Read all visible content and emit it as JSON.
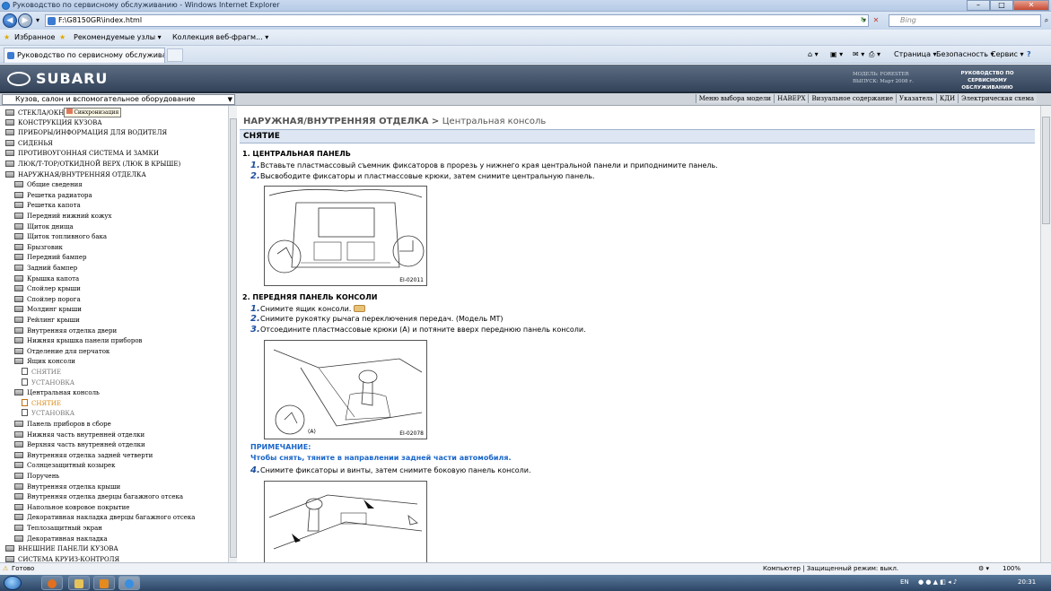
{
  "window": {
    "title": "Руководство по сервисному обслуживанию - Windows Internet Explorer"
  },
  "address": {
    "url": "F:\\G8150GR\\index.html",
    "search_placeholder": "Bing"
  },
  "favorites": {
    "label": "Избранное",
    "recommended": "Рекомендуемые узлы ▾",
    "gallery": "Коллекция веб-фрагм... ▾"
  },
  "tab": {
    "title": "Руководство по сервисному обслуживанию"
  },
  "commandbar": {
    "page": "Страница ▾",
    "safety": "Безопасность ▾",
    "tools": "Сервис ▾",
    "help": "?"
  },
  "banner": {
    "logo": "SUBARU",
    "model_line1": "МОДЕЛЬ: FORESTER",
    "model_line2": "ВЫПУСК: Март 2008 г.",
    "manual_line1": "РУКОВОДСТВО ПО",
    "manual_line2": "СЕРВИСНОМУ ОБСЛУЖИВАНИЮ"
  },
  "subbar": {
    "section": "Кузов, салон и вспомогательное оборудование",
    "links": [
      "Меню выбора модели",
      "НАВЕРХ",
      "Визуальное содержание",
      "Указатель",
      "КДИ",
      "Электрическая схема"
    ]
  },
  "tree": [
    {
      "label": "СТЕКЛА/ОКН",
      "level": 0,
      "kind": "folder"
    },
    {
      "label": "КОНСТРУКЦИЯ КУЗОВА",
      "level": 0,
      "kind": "folder"
    },
    {
      "label": "ПРИБОРЫ/ИНФОРМАЦИЯ ДЛЯ ВОДИТЕЛЯ",
      "level": 0,
      "kind": "folder"
    },
    {
      "label": "СИДЕНЬЯ",
      "level": 0,
      "kind": "folder"
    },
    {
      "label": "ПРОТИВОУГОННАЯ СИСТЕМА И ЗАМКИ",
      "level": 0,
      "kind": "folder"
    },
    {
      "label": "ЛЮК/Т-ТОР/ОТКИДНОЙ ВЕРХ (ЛЮК В КРЫШЕ)",
      "level": 0,
      "kind": "folder"
    },
    {
      "label": "НАРУЖНАЯ/ВНУТРЕННЯЯ ОТДЕЛКА",
      "level": 0,
      "kind": "folder"
    },
    {
      "label": "Общие сведения",
      "level": 1,
      "kind": "folder"
    },
    {
      "label": "Решетка радиатора",
      "level": 1,
      "kind": "folder"
    },
    {
      "label": "Решетка капота",
      "level": 1,
      "kind": "folder"
    },
    {
      "label": "Передний нижний кожух",
      "level": 1,
      "kind": "folder"
    },
    {
      "label": "Щиток днища",
      "level": 1,
      "kind": "folder"
    },
    {
      "label": "Щиток топливного бака",
      "level": 1,
      "kind": "folder"
    },
    {
      "label": "Брызговик",
      "level": 1,
      "kind": "folder"
    },
    {
      "label": "Передний бампер",
      "level": 1,
      "kind": "folder"
    },
    {
      "label": "Задний бампер",
      "level": 1,
      "kind": "folder"
    },
    {
      "label": "Крышка капота",
      "level": 1,
      "kind": "folder"
    },
    {
      "label": "Спойлер крыши",
      "level": 1,
      "kind": "folder"
    },
    {
      "label": "Спойлер порога",
      "level": 1,
      "kind": "folder"
    },
    {
      "label": "Молдинг крыши",
      "level": 1,
      "kind": "folder"
    },
    {
      "label": "Рейлинг крыши",
      "level": 1,
      "kind": "folder"
    },
    {
      "label": "Внутренняя отделка двери",
      "level": 1,
      "kind": "folder"
    },
    {
      "label": "Нижняя крышка панели приборов",
      "level": 1,
      "kind": "folder"
    },
    {
      "label": "Отделение для перчаток",
      "level": 1,
      "kind": "folder"
    },
    {
      "label": "Ящик консоли",
      "level": 1,
      "kind": "folder"
    },
    {
      "label": "СНЯТИЕ",
      "level": 2,
      "kind": "doc"
    },
    {
      "label": "УСТАНОВКА",
      "level": 2,
      "kind": "doc"
    },
    {
      "label": "Центральная консоль",
      "level": 1,
      "kind": "folder"
    },
    {
      "label": "СНЯТИЕ",
      "level": 2,
      "kind": "active"
    },
    {
      "label": "УСТАНОВКА",
      "level": 2,
      "kind": "doc"
    },
    {
      "label": "Панель приборов в сборе",
      "level": 1,
      "kind": "folder"
    },
    {
      "label": "Нижняя часть внутренней отделки",
      "level": 1,
      "kind": "folder"
    },
    {
      "label": "Верхняя часть внутренней отделки",
      "level": 1,
      "kind": "folder"
    },
    {
      "label": "Внутренняя отделка задней четверти",
      "level": 1,
      "kind": "folder"
    },
    {
      "label": "Солнцезащитный козырек",
      "level": 1,
      "kind": "folder"
    },
    {
      "label": "Поручень",
      "level": 1,
      "kind": "folder"
    },
    {
      "label": "Внутренняя отделка крыши",
      "level": 1,
      "kind": "folder"
    },
    {
      "label": "Внутренняя отделка дверцы багажного отсека",
      "level": 1,
      "kind": "folder"
    },
    {
      "label": "Напольное ковровое покрытие",
      "level": 1,
      "kind": "folder"
    },
    {
      "label": "Декоративная накладка дверцы багажного отсека",
      "level": 1,
      "kind": "folder"
    },
    {
      "label": "Теплозащитный экран",
      "level": 1,
      "kind": "folder"
    },
    {
      "label": "Декоративная накладка",
      "level": 1,
      "kind": "folder"
    },
    {
      "label": "ВНЕШНИЕ ПАНЕЛИ КУЗОВА",
      "level": 0,
      "kind": "folder"
    },
    {
      "label": "СИСТЕМА КРУИЗ-КОНТРОЛЯ",
      "level": 0,
      "kind": "folder"
    }
  ],
  "tooltip": "Синхронизация",
  "content": {
    "breadcrumb": "НАРУЖНАЯ/ВНУТРЕННЯЯ ОТДЕЛКА > ",
    "breadcrumb_current": "Центральная консоль",
    "section_title": "СНЯТИЕ",
    "h1": "1. ЦЕНТРАЛЬНАЯ ПАНЕЛЬ",
    "s1_1": "Вставьте пластмассовый съемник фиксаторов в прорезь у нижнего края центральной панели и приподнимите панель.",
    "s1_2": "Высвободите фиксаторы и пластмассовые крюки, затем снимите центральную панель.",
    "fig1": "EI-02011",
    "h2": "2. ПЕРЕДНЯЯ ПАНЕЛЬ КОНСОЛИ",
    "s2_1": "Снимите ящик консоли.",
    "s2_2": "Снимите рукоятку рычага переключения передач. (Модель МТ)",
    "s2_3": "Отсоедините пластмассовые крюки (А) и потяните вверх переднюю панель консоли.",
    "fig2": "EI-02078",
    "fig2_a": "(A)",
    "note_title": "ПРИМЕЧАНИЕ:",
    "note_text": "Чтобы снять, тяните в направлении задней части автомобиля.",
    "s2_4": "Снимите фиксаторы и винты, затем снимите боковую панель консоли.",
    "n1": "1.",
    "n2": "2.",
    "n3": "3.",
    "n4": "4."
  },
  "status": {
    "text": "Готово",
    "zone": "Компьютер | Защищенный режим: выкл.",
    "zoom": "100%"
  },
  "taskbar": {
    "lang": "EN",
    "time": "20:31"
  }
}
